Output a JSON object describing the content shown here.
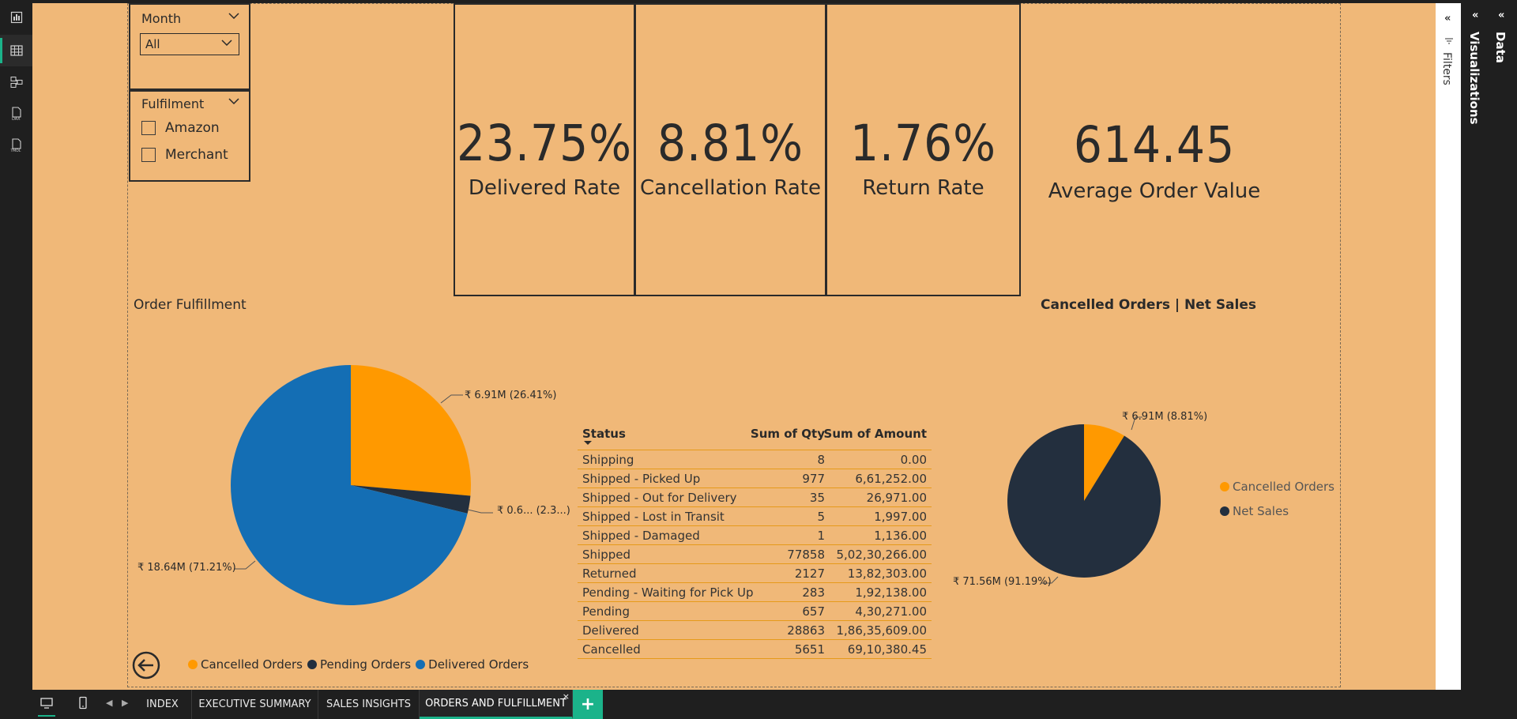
{
  "left_rail": {
    "items": [
      {
        "icon": "report-view-icon",
        "active": false
      },
      {
        "icon": "table-view-icon",
        "active": true
      },
      {
        "icon": "model-view-icon",
        "active": false
      },
      {
        "icon": "dax-query-icon",
        "label": "DAX"
      },
      {
        "icon": "tmdl-view-icon",
        "label": "TMDL"
      }
    ]
  },
  "slicers": {
    "month": {
      "title": "Month",
      "selected": "All"
    },
    "fulfilment": {
      "title": "Fulfilment",
      "options": [
        "Amazon",
        "Merchant"
      ]
    }
  },
  "kpis": [
    {
      "value": "23.75%",
      "label": "Delivered Rate"
    },
    {
      "value": "8.81%",
      "label": "Cancellation Rate"
    },
    {
      "value": "1.76%",
      "label": "Return Rate"
    },
    {
      "value": "614.45",
      "label": "Average Order Value"
    }
  ],
  "order_fulfillment": {
    "title": "Order Fulfillment",
    "labels": {
      "cancelled": "₹ 6.91M (26.41%)",
      "pending": "₹ 0.6... (2.3...)",
      "delivered": "₹ 18.64M (71.21%)"
    },
    "legend": [
      "Cancelled Orders",
      "Pending Orders",
      "Delivered Orders"
    ]
  },
  "cancelled_net": {
    "title": "Cancelled Orders | Net Sales",
    "labels": {
      "cancelled": "₹ 6.91M (8.81%)",
      "net": "₹ 71.56M (91.19%)"
    },
    "legend": [
      "Cancelled Orders",
      "Net Sales"
    ]
  },
  "status_table": {
    "headers": [
      "Status",
      "Sum of Qty",
      "Sum of Amount"
    ],
    "rows": [
      [
        "Shipping",
        "8",
        "0.00"
      ],
      [
        "Shipped - Picked Up",
        "977",
        "6,61,252.00"
      ],
      [
        "Shipped - Out for Delivery",
        "35",
        "26,971.00"
      ],
      [
        "Shipped - Lost in Transit",
        "5",
        "1,997.00"
      ],
      [
        "Shipped - Damaged",
        "1",
        "1,136.00"
      ],
      [
        "Shipped",
        "77858",
        "5,02,30,266.00"
      ],
      [
        "Returned",
        "2127",
        "13,82,303.00"
      ],
      [
        "Pending - Waiting for Pick Up",
        "283",
        "1,92,138.00"
      ],
      [
        "Pending",
        "657",
        "4,30,271.00"
      ],
      [
        "Delivered",
        "28863",
        "1,86,35,609.00"
      ],
      [
        "Cancelled",
        "5651",
        "69,10,380.45"
      ]
    ]
  },
  "side_panes": {
    "filters": "Filters",
    "visualizations": "Visualizations",
    "data": "Data"
  },
  "tabs": [
    {
      "label": "INDEX",
      "active": false
    },
    {
      "label": "EXECUTIVE SUMMARY",
      "active": false
    },
    {
      "label": "SALES INSIGHTS",
      "active": false
    },
    {
      "label": "ORDERS AND FULFILLMENT",
      "active": true
    }
  ],
  "colors": {
    "canvas": "#f0b878",
    "cancelled": "#ff9900",
    "pending": "#232f3e",
    "delivered": "#146eb4",
    "net": "#232f3e",
    "accent": "#1bb38a"
  },
  "chart_data": [
    {
      "type": "pie",
      "title": "Order Fulfillment",
      "categories": [
        "Cancelled Orders",
        "Pending Orders",
        "Delivered Orders"
      ],
      "values": [
        26.41,
        2.38,
        71.21
      ],
      "amounts": [
        "₹ 6.91M",
        "₹ 0.6...",
        "₹ 18.64M"
      ],
      "legend": "bottom"
    },
    {
      "type": "pie",
      "title": "Cancelled Orders | Net Sales",
      "categories": [
        "Cancelled Orders",
        "Net Sales"
      ],
      "values": [
        8.81,
        91.19
      ],
      "amounts": [
        "₹ 6.91M",
        "₹ 71.56M"
      ],
      "legend": "right"
    }
  ]
}
